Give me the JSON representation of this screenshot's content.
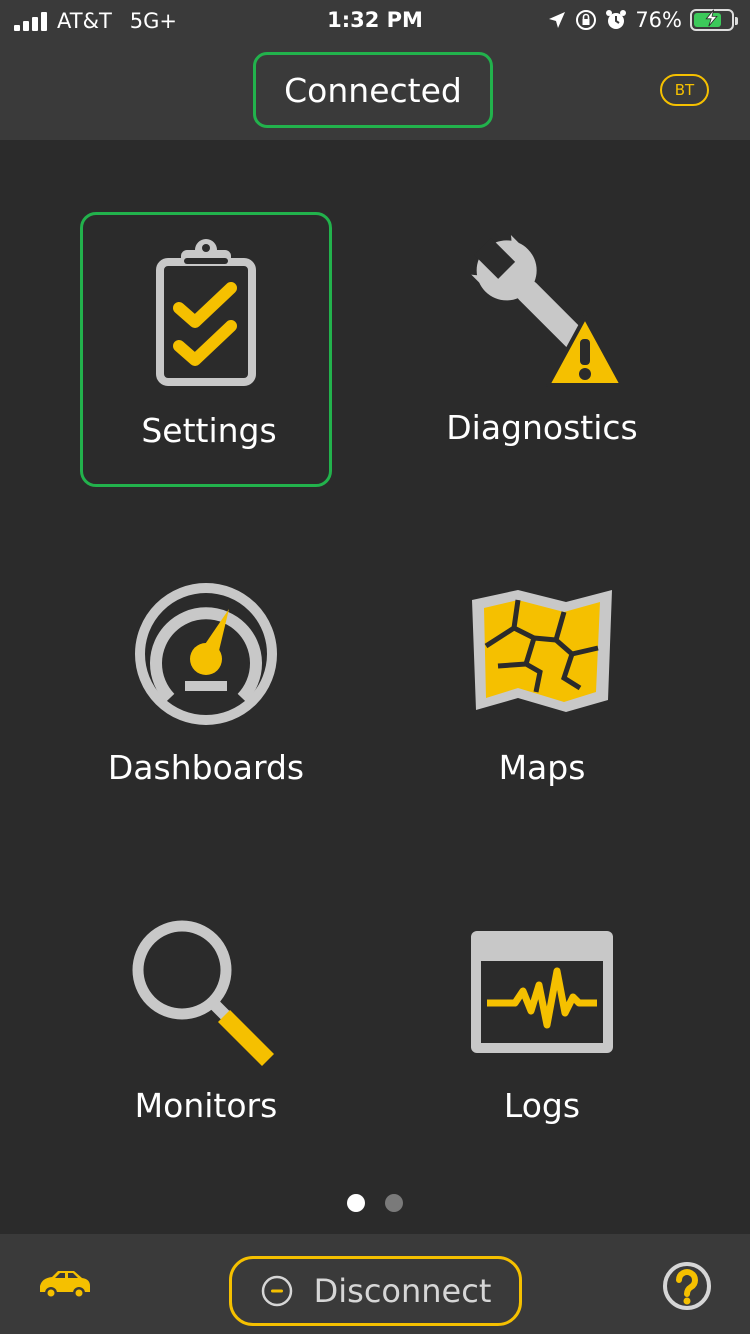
{
  "status_bar": {
    "carrier": "AT&T",
    "network": "5G+",
    "time": "1:32 PM",
    "battery": "76%",
    "battery_level": 0.76
  },
  "header": {
    "connection_status": "Connected",
    "bt_badge": "BT"
  },
  "menu": {
    "settings": "Settings",
    "diagnostics": "Diagnostics",
    "dashboards": "Dashboards",
    "maps": "Maps",
    "monitors": "Monitors",
    "logs": "Logs"
  },
  "pager": {
    "pages": 2,
    "current": 1
  },
  "bottom_bar": {
    "disconnect_label": "Disconnect"
  },
  "colors": {
    "accent": "#f5c000",
    "selected_border": "#22b24c",
    "icon_gray": "#c8c8c8",
    "background": "#2b2b2b",
    "bar": "#3a3a3a"
  }
}
